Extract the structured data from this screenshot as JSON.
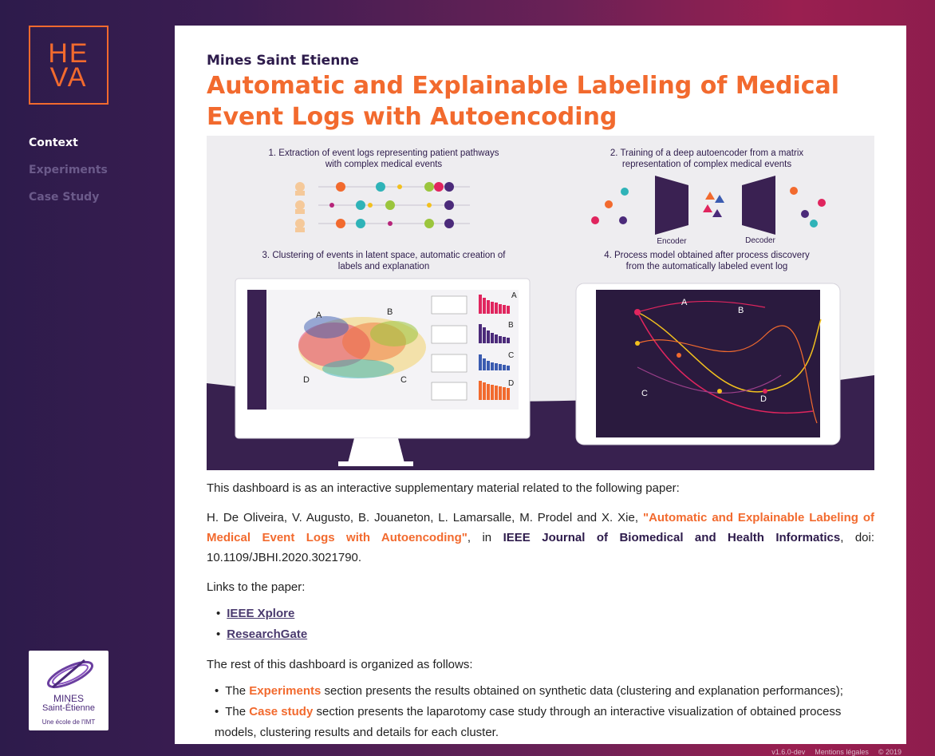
{
  "sidebar": {
    "logo": {
      "line1": "HE",
      "line2": "VA"
    },
    "nav": [
      "Context",
      "Experiments",
      "Case Study"
    ],
    "partner_logo": {
      "line1": "MINES",
      "line2": "Saint-Étienne",
      "line3": "Une école de l'IMT"
    }
  },
  "main": {
    "organization": "Mines Saint Etienne",
    "title": "Automatic and Explainable Labeling of Medical Event Logs with Autoencoding",
    "figure": {
      "step1": [
        "1. Extraction of event logs representing patient pathways",
        "with complex medical events"
      ],
      "step2": [
        "2. Training of a deep autoencoder from a matrix",
        "representation of complex medical events"
      ],
      "step3": [
        "3. Clustering of events in latent space, automatic creation of",
        "labels and explanation"
      ],
      "step4": [
        "4. Process model obtained after process discovery",
        "from the automatically labeled event log"
      ],
      "encoder_label": "Encoder",
      "decoder_label": "Decoder",
      "cluster_letters": [
        "A",
        "B",
        "C",
        "D"
      ]
    },
    "intro": "This dashboard is as an interactive supplementary material related to the following paper:",
    "citation": {
      "authors": "H. De Oliveira, V. Augusto, B. Jouaneton, L. Lamarsalle, M. Prodel and X. Xie, ",
      "paper_title": "\"Automatic and Explainable Labeling of Medical Event Logs with Autoencoding\"",
      "in": ", in ",
      "journal": "IEEE Journal of Biomedical and Health Informatics",
      "doi": ",  doi: 10.1109/JBHI.2020.3021790."
    },
    "links_intro": "Links to the paper:",
    "links": [
      "IEEE Xplore",
      "ResearchGate"
    ],
    "org_intro": "The rest of this dashboard is organized as follows:",
    "org_items": [
      {
        "prefix": "The ",
        "highlight": "Experiments",
        "suffix": " section presents the results obtained on synthetic data (clustering and explanation performances);"
      },
      {
        "prefix": "The ",
        "highlight": "Case study",
        "suffix": " section presents the laparotomy case study through an interactive visualization of obtained process models, clustering results and details for each cluster."
      }
    ]
  },
  "footer": {
    "version": "v1.6.0-dev",
    "legal": "Mentions légales",
    "copyright": "© 2019"
  },
  "colors": {
    "accent": "#f26a2e",
    "brand_dark": "#2d1b4b"
  }
}
